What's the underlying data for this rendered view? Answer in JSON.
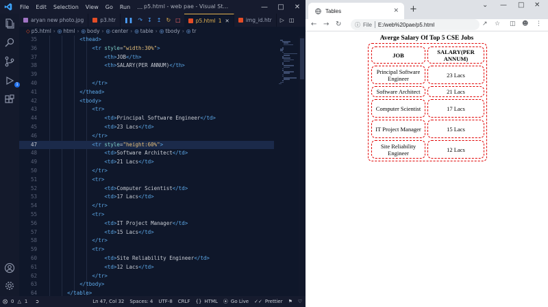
{
  "vscode": {
    "menu": [
      "File",
      "Edit",
      "Selection",
      "View",
      "Go",
      "Run",
      "…"
    ],
    "window_title": "p5.html - web pae - Visual St...",
    "tabs": [
      {
        "label": "aryan new photo.jpg",
        "icon_color": "#a074c4"
      },
      {
        "label": "p3.htr",
        "icon_color": "#e44d26"
      },
      {
        "label": "p5.html",
        "icon_color": "#e44d26",
        "active": true,
        "dirty": "1"
      },
      {
        "label": "img_id.htr",
        "icon_color": "#e44d26"
      }
    ],
    "breadcrumb": [
      "p5.html",
      "html",
      "body",
      "center",
      "table",
      "tbody",
      "tr"
    ],
    "current_line": 47,
    "code_lines": [
      {
        "n": "35",
        "indent": 12,
        "parts": [
          {
            "c": "tag",
            "t": "<thead>"
          }
        ]
      },
      {
        "n": "36",
        "indent": 16,
        "parts": [
          {
            "c": "tag",
            "t": "<tr "
          },
          {
            "c": "attr",
            "t": "style"
          },
          {
            "c": "txt",
            "t": "="
          },
          {
            "c": "str",
            "t": "\"width:30%\""
          },
          {
            "c": "tag",
            "t": ">"
          }
        ]
      },
      {
        "n": "37",
        "indent": 20,
        "parts": [
          {
            "c": "tag",
            "t": "<th>"
          },
          {
            "c": "txt",
            "t": "JOB"
          },
          {
            "c": "tag",
            "t": "</th>"
          }
        ]
      },
      {
        "n": "38",
        "indent": 20,
        "parts": [
          {
            "c": "tag",
            "t": "<th>"
          },
          {
            "c": "txt",
            "t": "SALARY(PER ANNUM)"
          },
          {
            "c": "tag",
            "t": "</th>"
          }
        ]
      },
      {
        "n": "39",
        "indent": 0,
        "parts": []
      },
      {
        "n": "40",
        "indent": 16,
        "parts": [
          {
            "c": "tag",
            "t": "</tr>"
          }
        ]
      },
      {
        "n": "41",
        "indent": 12,
        "parts": [
          {
            "c": "tag",
            "t": "</thead>"
          }
        ]
      },
      {
        "n": "42",
        "indent": 12,
        "parts": [
          {
            "c": "tag",
            "t": "<tbody>"
          }
        ]
      },
      {
        "n": "43",
        "indent": 16,
        "parts": [
          {
            "c": "tag",
            "t": "<tr>"
          }
        ]
      },
      {
        "n": "44",
        "indent": 20,
        "parts": [
          {
            "c": "tag",
            "t": "<td>"
          },
          {
            "c": "txt",
            "t": "Principal Software Engineer"
          },
          {
            "c": "tag",
            "t": "</td>"
          }
        ]
      },
      {
        "n": "45",
        "indent": 20,
        "parts": [
          {
            "c": "tag",
            "t": "<td>"
          },
          {
            "c": "txt",
            "t": "23 Lacs"
          },
          {
            "c": "tag",
            "t": "</td>"
          }
        ]
      },
      {
        "n": "46",
        "indent": 16,
        "parts": [
          {
            "c": "tag",
            "t": "</tr>"
          }
        ]
      },
      {
        "n": "47",
        "indent": 16,
        "parts": [
          {
            "c": "tag",
            "t": "<tr "
          },
          {
            "c": "attr",
            "t": "style"
          },
          {
            "c": "txt",
            "t": "="
          },
          {
            "c": "str",
            "t": "\"height:60%\""
          },
          {
            "c": "tag",
            "t": ">"
          }
        ]
      },
      {
        "n": "48",
        "indent": 20,
        "parts": [
          {
            "c": "tag",
            "t": "<td>"
          },
          {
            "c": "txt",
            "t": "Software Architect"
          },
          {
            "c": "tag",
            "t": "</td>"
          }
        ]
      },
      {
        "n": "49",
        "indent": 20,
        "parts": [
          {
            "c": "tag",
            "t": "<td>"
          },
          {
            "c": "txt",
            "t": "21 Lacs"
          },
          {
            "c": "tag",
            "t": "</td>"
          }
        ]
      },
      {
        "n": "50",
        "indent": 16,
        "parts": [
          {
            "c": "tag",
            "t": "</tr>"
          }
        ]
      },
      {
        "n": "51",
        "indent": 16,
        "parts": [
          {
            "c": "tag",
            "t": "<tr>"
          }
        ]
      },
      {
        "n": "52",
        "indent": 20,
        "parts": [
          {
            "c": "tag",
            "t": "<td>"
          },
          {
            "c": "txt",
            "t": "Computer Scientist"
          },
          {
            "c": "tag",
            "t": "</td>"
          }
        ]
      },
      {
        "n": "53",
        "indent": 20,
        "parts": [
          {
            "c": "tag",
            "t": "<td>"
          },
          {
            "c": "txt",
            "t": "17 Lacs"
          },
          {
            "c": "tag",
            "t": "</td>"
          }
        ]
      },
      {
        "n": "54",
        "indent": 16,
        "parts": [
          {
            "c": "tag",
            "t": "</tr>"
          }
        ]
      },
      {
        "n": "55",
        "indent": 16,
        "parts": [
          {
            "c": "tag",
            "t": "<tr>"
          }
        ]
      },
      {
        "n": "56",
        "indent": 20,
        "parts": [
          {
            "c": "tag",
            "t": "<td>"
          },
          {
            "c": "txt",
            "t": "IT Project Manager"
          },
          {
            "c": "tag",
            "t": "</td>"
          }
        ]
      },
      {
        "n": "57",
        "indent": 20,
        "parts": [
          {
            "c": "tag",
            "t": "<td>"
          },
          {
            "c": "txt",
            "t": "15 Lacs"
          },
          {
            "c": "tag",
            "t": "</td>"
          }
        ]
      },
      {
        "n": "58",
        "indent": 16,
        "parts": [
          {
            "c": "tag",
            "t": "</tr>"
          }
        ]
      },
      {
        "n": "59",
        "indent": 16,
        "parts": [
          {
            "c": "tag",
            "t": "<tr>"
          }
        ]
      },
      {
        "n": "60",
        "indent": 20,
        "parts": [
          {
            "c": "tag",
            "t": "<td>"
          },
          {
            "c": "txt",
            "t": "Site Reliability Engineer"
          },
          {
            "c": "tag",
            "t": "</td>"
          }
        ]
      },
      {
        "n": "61",
        "indent": 20,
        "parts": [
          {
            "c": "tag",
            "t": "<td>"
          },
          {
            "c": "txt",
            "t": "12 Lacs"
          },
          {
            "c": "tag",
            "t": "</td>"
          }
        ]
      },
      {
        "n": "62",
        "indent": 16,
        "parts": [
          {
            "c": "tag",
            "t": "</tr>"
          }
        ]
      },
      {
        "n": "63",
        "indent": 12,
        "parts": [
          {
            "c": "tag",
            "t": "</tbody>"
          }
        ]
      },
      {
        "n": "64",
        "indent": 8,
        "parts": [
          {
            "c": "tag",
            "t": "</table>"
          }
        ]
      }
    ],
    "status": {
      "errors": "0",
      "warnings": "1",
      "position": "Ln 47, Col 32",
      "spaces": "Spaces: 4",
      "encoding": "UTF-8",
      "eol": "CRLF",
      "language": "HTML",
      "go_live": "Go Live",
      "prettier": "Prettier"
    },
    "explorer_badge": "1",
    "colors": {
      "accent_tab": "#e6b450",
      "tag": "#5da9e9",
      "attr": "#7fd0c9",
      "string": "#e6c07b"
    }
  },
  "browser": {
    "tab_title": "Tables",
    "file_label": "File",
    "url": "E:/web%20pae/p5.html",
    "page": {
      "caption": "Averge Salary Of Top 5 CSE Jobs",
      "headers": [
        "JOB",
        "SALARY(PER ANNUM)"
      ],
      "rows": [
        [
          "Principal Software Engineer",
          "23 Lacs"
        ],
        [
          "Software Architect",
          "21 Lacs"
        ],
        [
          "Computer Scientist",
          "17 Lacs"
        ],
        [
          "IT Project Manager",
          "15 Lacs"
        ],
        [
          "Site Reliability Engineer",
          "12 Lacs"
        ]
      ],
      "border_color": "#e00000"
    }
  }
}
